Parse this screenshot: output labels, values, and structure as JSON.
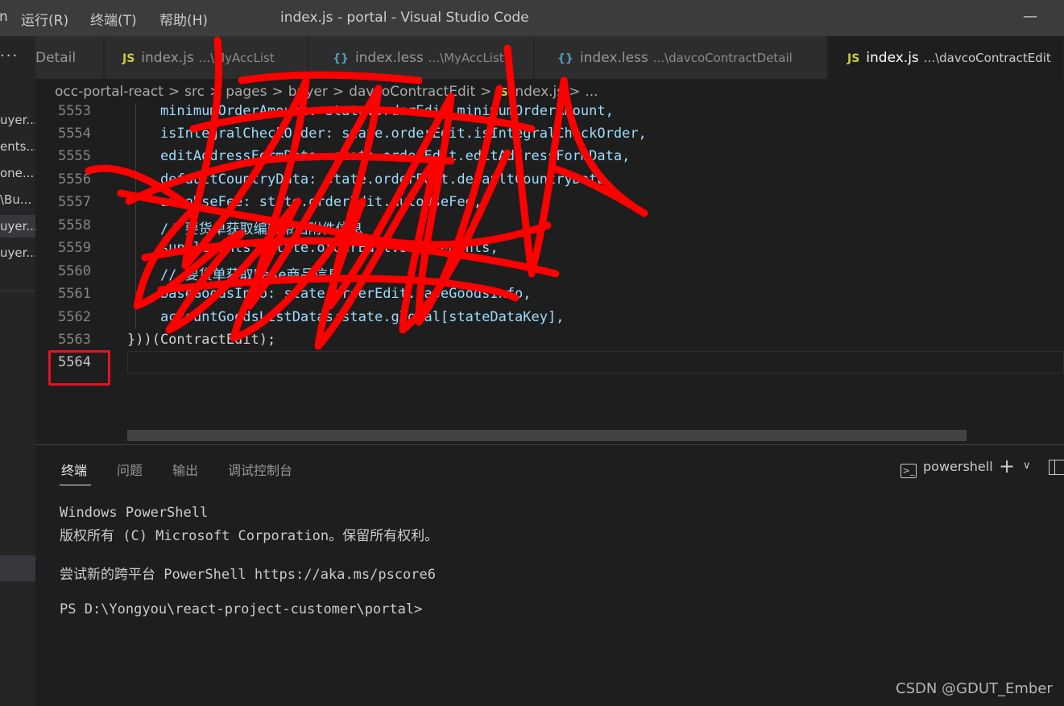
{
  "titlebar": {
    "menu_fragment": "n",
    "menus": [
      "运行(R)",
      "终端(T)",
      "帮助(H)"
    ],
    "window_title": "index.js - portal - Visual Studio Code",
    "minimize_glyph": "—"
  },
  "explorer": {
    "more_glyph": "···",
    "items": [
      "uyer...",
      "ents...",
      "one...",
      "\\Bu...",
      "uyer...",
      "uyer..."
    ]
  },
  "tabs": [
    {
      "icon": "",
      "name": "Detail",
      "path": ""
    },
    {
      "icon": "JS",
      "name": "index.js",
      "path": "...\\MyAccList"
    },
    {
      "icon": "{}",
      "name": "index.less",
      "path": "...\\MyAccList"
    },
    {
      "icon": "{}",
      "name": "index.less",
      "path": "...\\davcoContractDetail"
    },
    {
      "icon": "JS",
      "name": "index.js",
      "path": "...\\davcoContractEdit"
    }
  ],
  "breadcrumb": {
    "items": [
      "occ-portal-react",
      "src",
      "pages",
      "buyer",
      "davcoContractEdit",
      "index.js",
      "..."
    ],
    "js_badge": "JS"
  },
  "editor": {
    "lines": [
      {
        "num": "5553",
        "text": "    minimumOrderAmount: state.orderEdit.minimumOrderAmount,"
      },
      {
        "num": "5554",
        "text": "    isIntegralCheckOrder: state.orderEdit.isIntegralCheckOrder,"
      },
      {
        "num": "5555",
        "text": "    editAddressFormData: state.orderEdit.editAddressFormData,"
      },
      {
        "num": "5556",
        "text": "    defaultCountryData: state.orderEdit.defaultCountryData,"
      },
      {
        "num": "5557",
        "text": "    autoUseFee: state.orderEdit.autoUseFee,"
      },
      {
        "num": "5558",
        "text": "    // 要货单获取编辑带出附件信息"
      },
      {
        "num": "5559",
        "text": "    supplements: state.orderEdit.supplements,"
      },
      {
        "num": "5560",
        "text": "    // 要货单获取base商品信息"
      },
      {
        "num": "5561",
        "text": "    baseGoodsInfo: state.orderEdit.baseGoodsInfo,"
      },
      {
        "num": "5562",
        "text": "    accountGoodsListDatas:state.global[stateDataKey],"
      },
      {
        "num": "5563",
        "text": "}))(ContractEdit);"
      },
      {
        "num": "5564",
        "text": ""
      }
    ]
  },
  "panel": {
    "tabs": [
      "终端",
      "问题",
      "输出",
      "调试控制台"
    ],
    "shell_name": "powershell",
    "shell_icon": ">_",
    "add_glyph": "+",
    "chevron_glyph": "∨",
    "terminal_lines": [
      "Windows PowerShell",
      "版权所有 (C) Microsoft Corporation。保留所有权利。",
      "",
      "尝试新的跨平台 PowerShell https://aka.ms/pscore6",
      "",
      "PS D:\\Yongyou\\react-project-customer\\portal>"
    ]
  },
  "watermark": "CSDN @GDUT_Ember",
  "colors": {
    "accent_red": "#e81123",
    "editor_bg": "#1e1e1e",
    "js_icon": "#cbcb41",
    "less_icon": "#519aba"
  }
}
